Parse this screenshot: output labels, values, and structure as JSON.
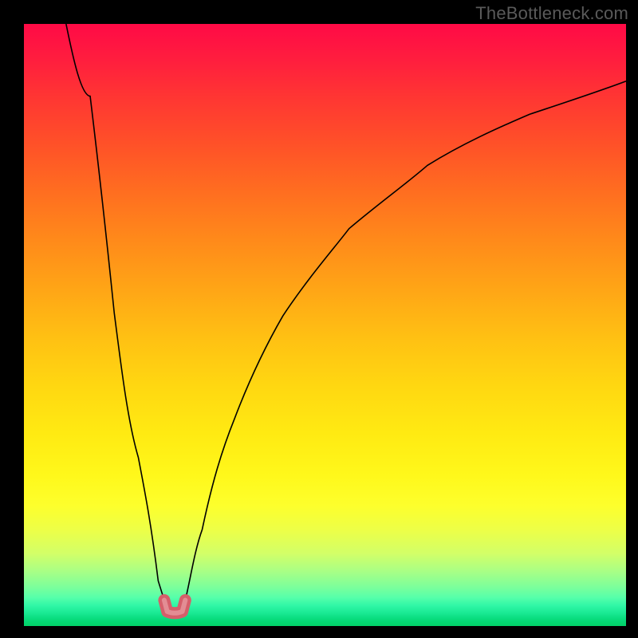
{
  "watermark": "TheBottleneck.com",
  "colors": {
    "frame": "#000000",
    "curve": "#000000",
    "marker": "#d55f6a",
    "marker_glow": "#e38d94",
    "gradient_top": "#ff0a46",
    "gradient_bottom": "#02d268"
  },
  "chart_data": {
    "type": "line",
    "title": "",
    "xlabel": "",
    "ylabel": "",
    "xlim": [
      0,
      100
    ],
    "ylim": [
      0,
      100
    ],
    "series": [
      {
        "name": "left-branch",
        "x": [
          7,
          9,
          11,
          13,
          15,
          17,
          19,
          21,
          22.3,
          23.3
        ],
        "y": [
          100,
          88,
          76,
          64,
          52,
          40,
          28,
          15.5,
          7.5,
          4.3
        ]
      },
      {
        "name": "right-branch",
        "x": [
          26.8,
          27.8,
          29.6,
          32,
          35,
          38.5,
          43,
          48,
          54,
          60,
          67,
          75,
          84,
          92,
          100
        ],
        "y": [
          4.3,
          7.5,
          16,
          25,
          34.5,
          43,
          51.5,
          59,
          66,
          71.5,
          76.5,
          81,
          85,
          88,
          90.5
        ]
      },
      {
        "name": "minimum-marker",
        "x": [
          23.3,
          23.8,
          25.05,
          26.3,
          26.8
        ],
        "y": [
          4.3,
          2.4,
          1.9,
          2.4,
          4.3
        ]
      }
    ],
    "annotations": []
  }
}
